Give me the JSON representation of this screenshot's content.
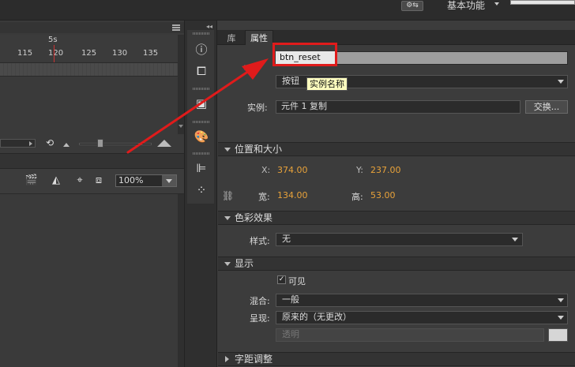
{
  "topbar": {
    "sync_label": "⚙⇆",
    "workspace_label": "基本功能"
  },
  "timeline": {
    "ruler_seconds_label": "5s",
    "ruler_frames": [
      "115",
      "120",
      "125",
      "130",
      "135"
    ]
  },
  "stage_toolbar": {
    "zoom_value": "100%"
  },
  "properties": {
    "tabs": [
      {
        "label": "库",
        "active": false
      },
      {
        "label": "属性",
        "active": true
      }
    ],
    "instance_name_value": "btn_reset",
    "tooltip_text": "实例名称",
    "symbol_type_value": "按钮",
    "instance_label": "实例:",
    "instance_value": "元件 1 复制",
    "swap_button_label": "交换...",
    "sections": {
      "position_size": "位置和大小",
      "color_effect": "色彩效果",
      "display": "显示",
      "tracking": "字距调整"
    },
    "position": {
      "x_label": "X:",
      "x_value": "374.00",
      "y_label": "Y:",
      "y_value": "237.00",
      "w_label": "宽:",
      "w_value": "134.00",
      "h_label": "高:",
      "h_value": "53.00"
    },
    "color_effect": {
      "style_label": "样式:",
      "style_value": "无"
    },
    "display": {
      "visible_label": "可见",
      "visible_checked": true,
      "blend_label": "混合:",
      "blend_value": "一般",
      "render_label": "呈现:",
      "render_value": "原来的（无更改）",
      "transparent_label": "透明"
    }
  },
  "colors": {
    "highlight_red": "#e01b1b",
    "value_orange": "#e8a23a",
    "tooltip_bg": "#fefebf"
  }
}
